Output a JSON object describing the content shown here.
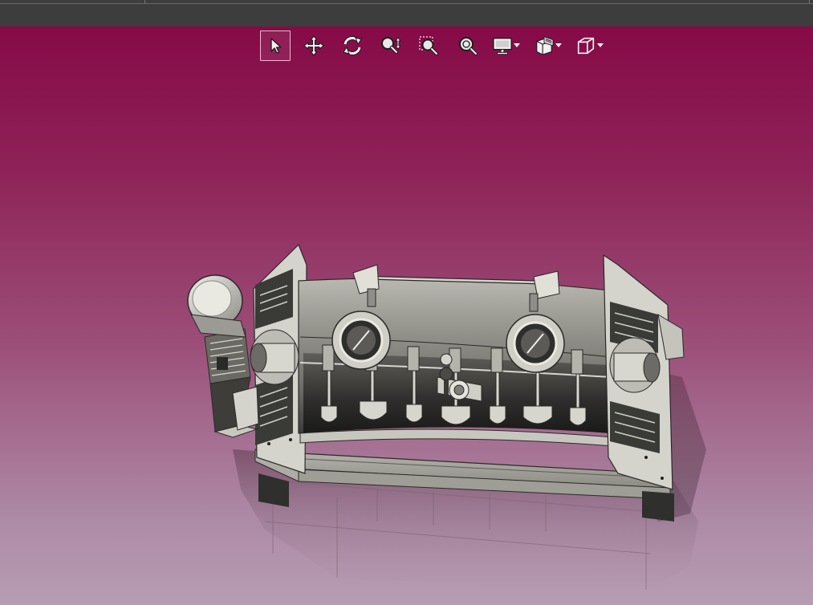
{
  "window": {
    "title_text": ""
  },
  "toolbar": {
    "tools": [
      {
        "id": "select",
        "icon": "cursor-icon",
        "active": true
      },
      {
        "id": "pan",
        "icon": "move-arrows-icon"
      },
      {
        "id": "rotate",
        "icon": "rotate-icon"
      },
      {
        "id": "zoom",
        "icon": "zoom-updown-icon"
      },
      {
        "id": "zoom-window",
        "icon": "zoom-window-icon"
      },
      {
        "id": "zoom-fit",
        "icon": "zoom-fit-icon"
      },
      {
        "id": "display",
        "icon": "monitor-icon",
        "has_menu": true
      },
      {
        "id": "section",
        "icon": "section-view-icon",
        "has_menu": true
      },
      {
        "id": "view-cube",
        "icon": "view-cube-icon",
        "has_menu": true
      }
    ]
  },
  "viewport": {
    "background_top": "#860a47",
    "background_bottom": "#b79db3",
    "model_subject": "horizontal-paddle-mixer-3d-model"
  }
}
